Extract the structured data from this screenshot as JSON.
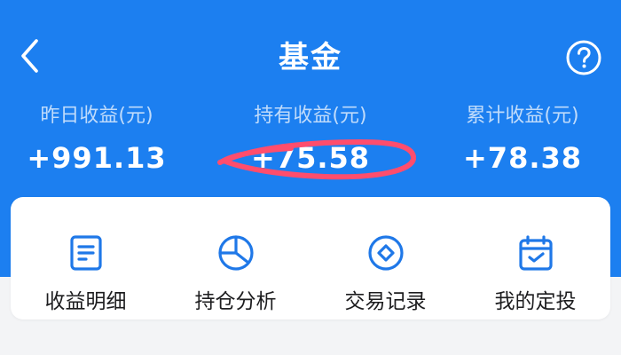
{
  "header": {
    "title": "基金",
    "back_icon": "chevron-left-icon",
    "help_icon": "question-circle-icon",
    "background_color": "#1c7ff0"
  },
  "stats": [
    {
      "label": "昨日收益(元)",
      "value": "+991.13"
    },
    {
      "label": "持有收益(元)",
      "value": "+75.58"
    },
    {
      "label": "累计收益(元)",
      "value": "+78.38"
    }
  ],
  "actions": [
    {
      "label": "收益明细",
      "icon": "document-list-icon"
    },
    {
      "label": "持仓分析",
      "icon": "pie-chart-icon"
    },
    {
      "label": "交易记录",
      "icon": "diamond-circle-icon"
    },
    {
      "label": "我的定投",
      "icon": "calendar-check-icon"
    }
  ],
  "colors": {
    "brand_blue": "#1c7ff0",
    "icon_blue": "#1f78e8",
    "annotation_red": "#ff4d6d"
  }
}
